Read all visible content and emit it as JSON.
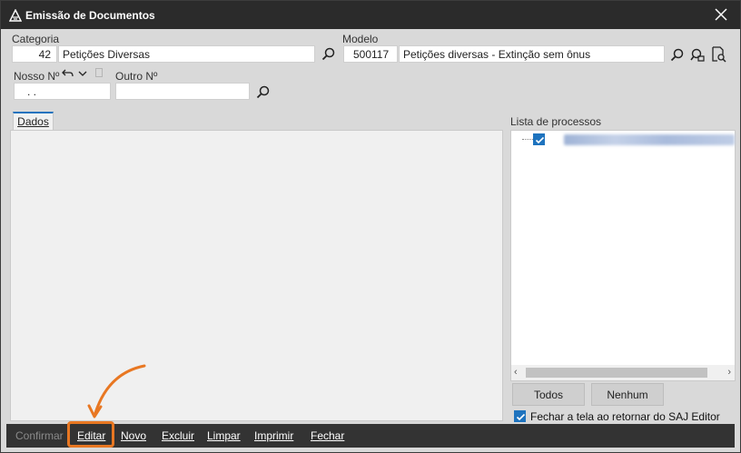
{
  "window": {
    "title": "Emissão de Documentos",
    "app_icon": "saj-logo-icon",
    "close_icon": "close-icon"
  },
  "categoria": {
    "label": "Categoria",
    "code": "42",
    "name": "Petições Diversas"
  },
  "modelo": {
    "label": "Modelo",
    "code": "500117",
    "name": "Petições diversas - Extinção sem ônus"
  },
  "nosso": {
    "label": "Nosso Nº",
    "value": " .  ."
  },
  "outro": {
    "label": "Outro Nº",
    "value": ""
  },
  "tabs": [
    {
      "label": "Dados"
    }
  ],
  "processos": {
    "label": "Lista de processos",
    "items": [
      {
        "checked": true
      }
    ]
  },
  "buttons": {
    "todos": "Todos",
    "nenhum": "Nenhum"
  },
  "fechar_check": {
    "label": "Fechar a tela ao retornar do SAJ Editor",
    "checked": true
  },
  "toolbar": {
    "confirmar": "Confirmar",
    "editar": "Editar",
    "novo": "Novo",
    "excluir": "Excluir",
    "limpar": "Limpar",
    "imprimir": "Imprimir",
    "fechar": "Fechar"
  },
  "annotation": {
    "color": "#e87722",
    "target": "Editar"
  }
}
